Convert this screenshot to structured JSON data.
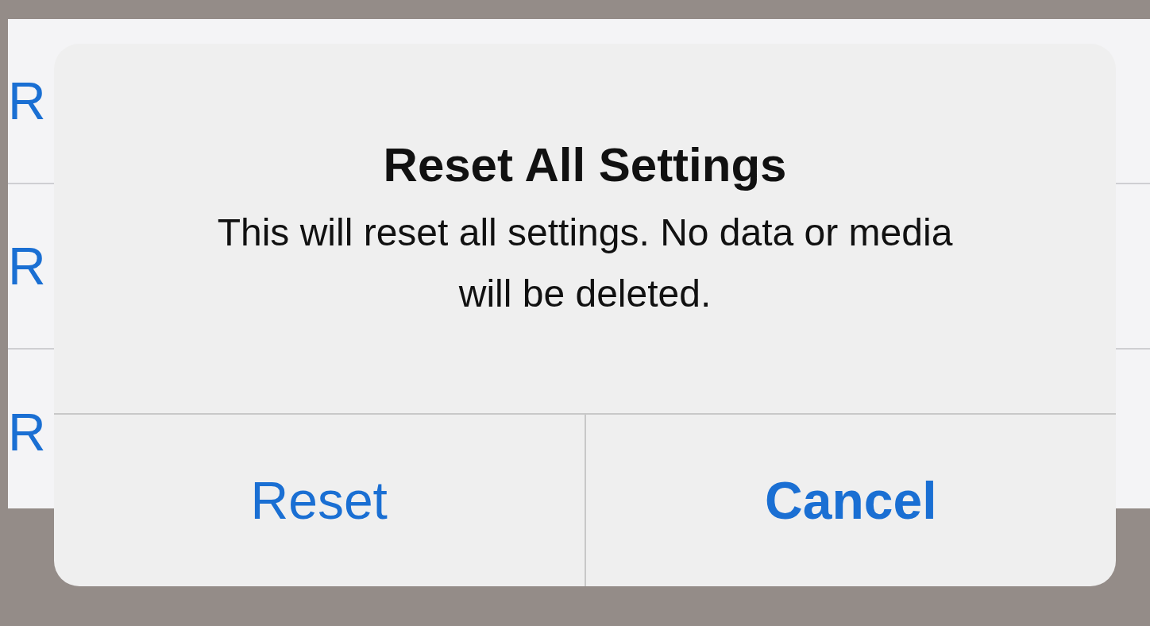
{
  "settings_list": {
    "items": [
      {
        "label": "R"
      },
      {
        "label": "R"
      },
      {
        "label": "R"
      }
    ]
  },
  "alert": {
    "title": "Reset All Settings",
    "message": "This will reset all settings. No data or media will be deleted.",
    "buttons": [
      {
        "label": "Reset",
        "kind": "action"
      },
      {
        "label": "Cancel",
        "kind": "cancel"
      }
    ]
  }
}
